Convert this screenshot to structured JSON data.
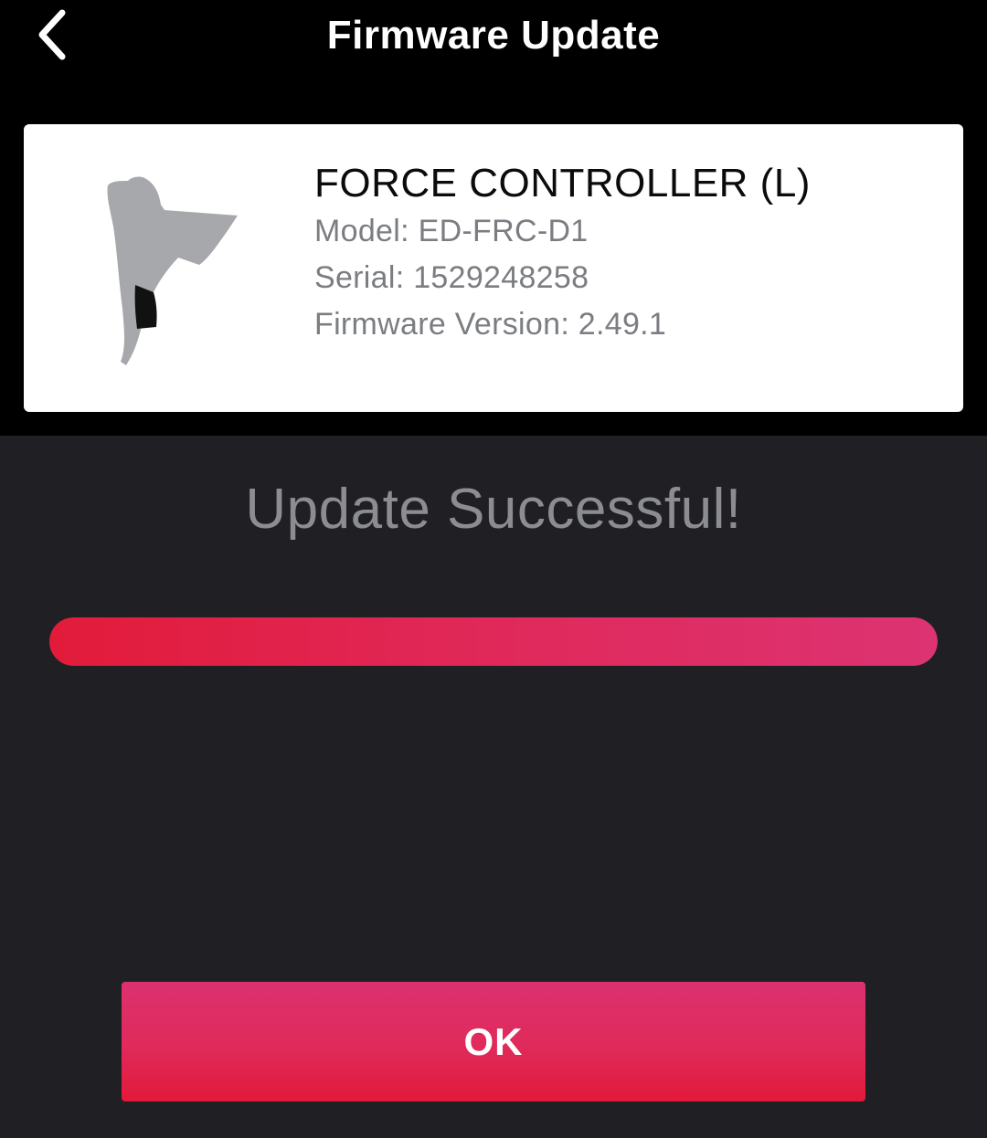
{
  "header": {
    "back_icon": "chevron-left-icon",
    "title": "Firmware Update"
  },
  "device": {
    "image_icon": "brake-lever-icon",
    "name": "FORCE CONTROLLER (L)",
    "model": "Model: ED-FRC-D1",
    "serial": "Serial: 1529248258",
    "firmware": "Firmware Version: 2.49.1"
  },
  "status": {
    "message": "Update Successful!",
    "progress_percent": 100
  },
  "actions": {
    "ok_label": "OK"
  },
  "colors": {
    "background": "#202024",
    "header_background": "#000000",
    "accent_start": "#e21b3a",
    "accent_end": "#dc3372",
    "status_text": "#8b8d92"
  }
}
